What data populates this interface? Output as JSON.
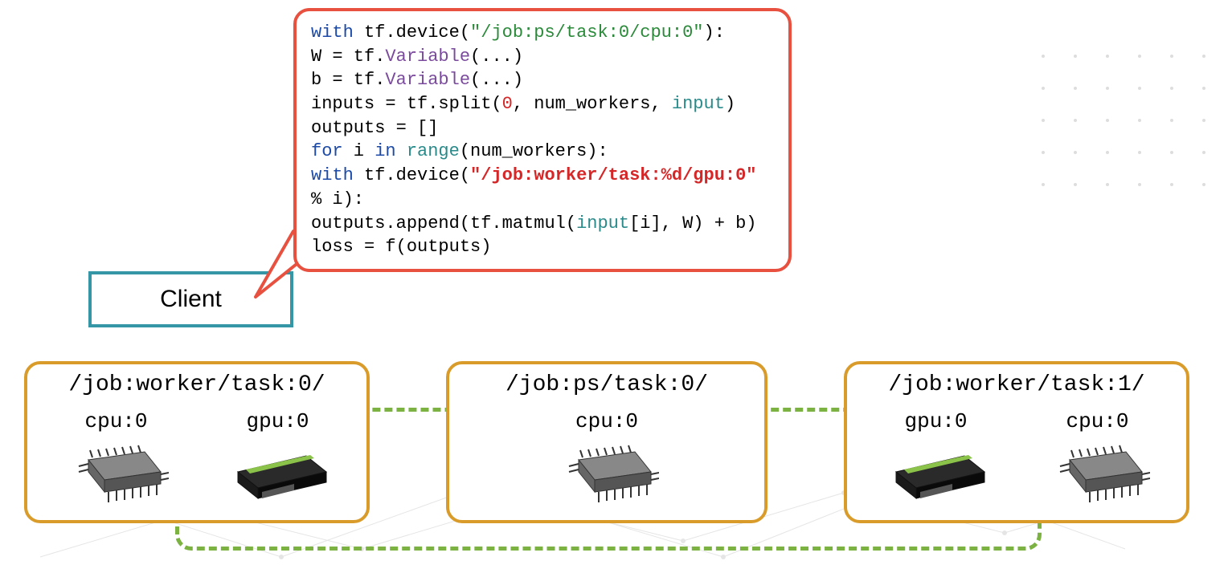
{
  "code": {
    "l1a": "with",
    "l1b": " tf.device(",
    "l1c": "\"/job:ps/task:0/cpu:0\"",
    "l1d": "):",
    "l2a": "  W = tf.",
    "l2b": "Variable",
    "l2c": "(...)",
    "l3a": "  b = tf.",
    "l3b": "Variable",
    "l3c": "(...)",
    "l4a": "inputs = tf.split(",
    "l4b": "0",
    "l4c": ", num_workers, ",
    "l4d": "input",
    "l4e": ")",
    "l5": "outputs = []",
    "l6a": "for",
    "l6b": " i ",
    "l6c": "in",
    "l6d": " ",
    "l6e": "range",
    "l6f": "(num_workers):",
    "l7a": "  ",
    "l7b": "with",
    "l7c": " tf.device(",
    "l7d": "\"/job:worker/task:%d/gpu:0\"",
    "l7e": " % i):",
    "l8a": "    outputs.append(tf.matmul(",
    "l8b": "input",
    "l8c": "[i], W) + b)",
    "l9": "loss = f(outputs)"
  },
  "client": "Client",
  "tasks": {
    "worker0": {
      "title": "/job:worker/task:0/",
      "cpu": "cpu:0",
      "gpu": "gpu:0"
    },
    "ps0": {
      "title": "/job:ps/task:0/",
      "cpu": "cpu:0"
    },
    "worker1": {
      "title": "/job:worker/task:1/",
      "gpu": "gpu:0",
      "cpu": "cpu:0"
    }
  }
}
